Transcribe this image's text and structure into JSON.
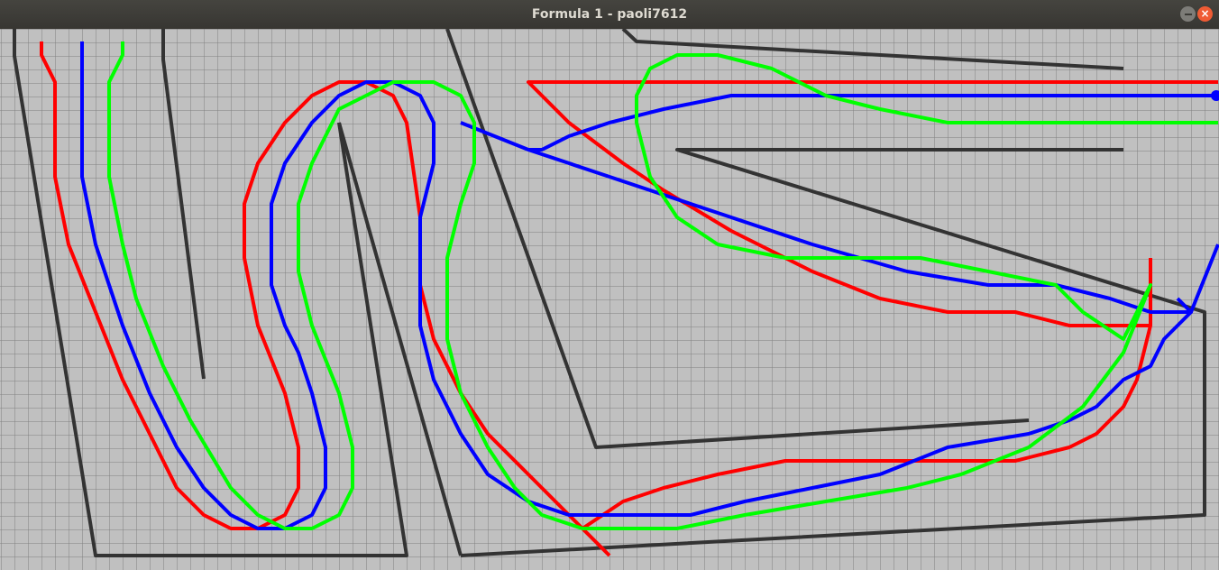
{
  "window": {
    "title": "Formula 1 - paoli7612",
    "close_label": "×"
  },
  "colors": {
    "background": "#c0c0c0",
    "grid": "#808080",
    "walls": "#333333",
    "path_red": "#ff0000",
    "path_blue": "#0000ff",
    "path_green": "#00ff00"
  }
}
